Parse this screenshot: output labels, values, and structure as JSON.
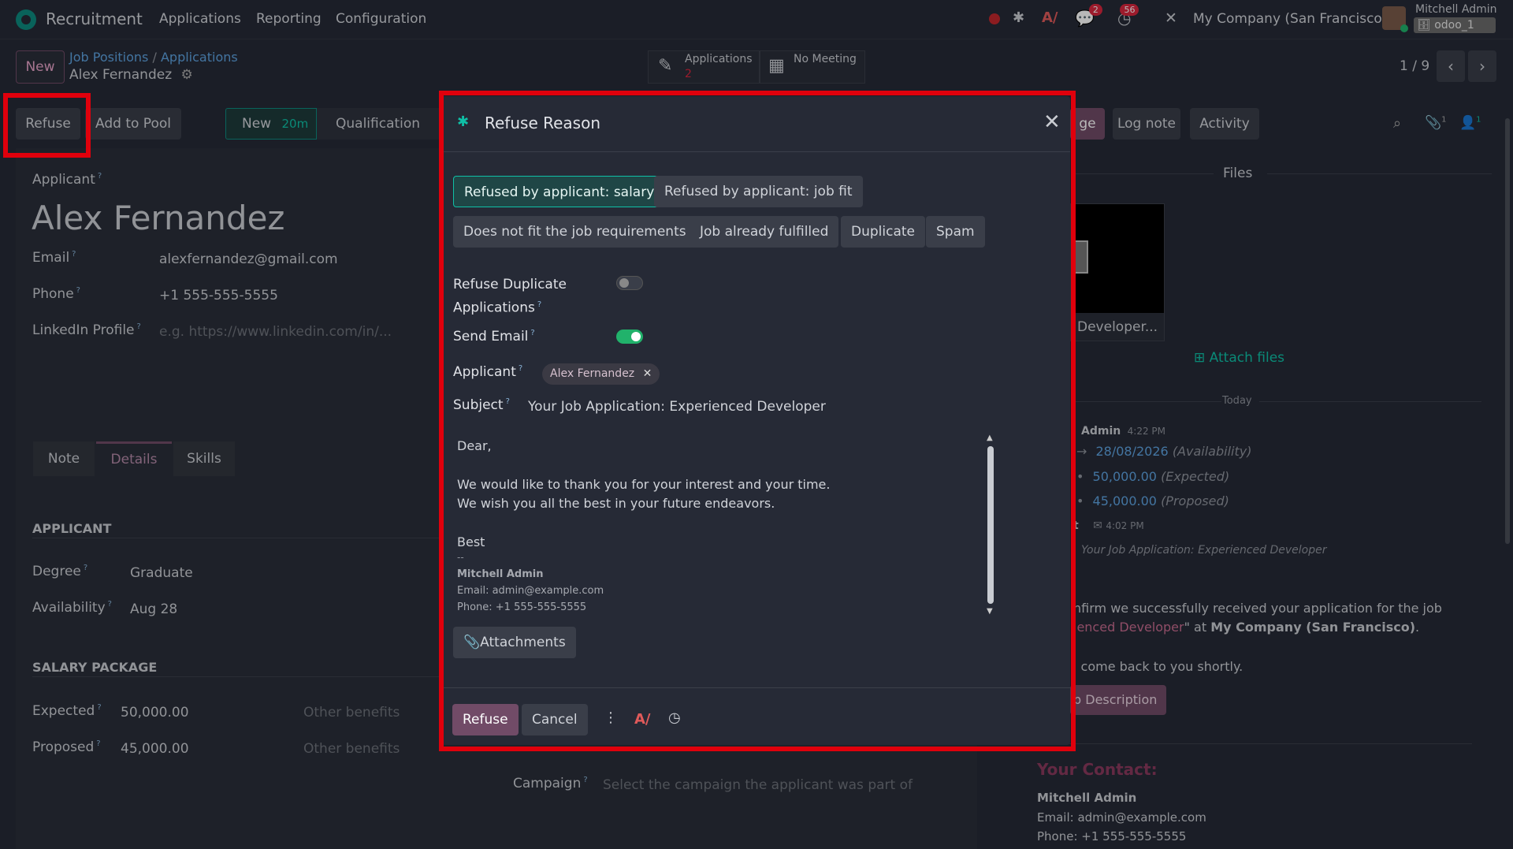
{
  "navbar": {
    "app_name": "Recruitment",
    "menu": [
      "Applications",
      "Reporting",
      "Configuration"
    ],
    "chat_badge": "2",
    "activity_badge": "56",
    "company": "My Company (San Francisco)",
    "user_name": "Mitchell Admin",
    "db_name": "odoo_1"
  },
  "control": {
    "new_button": "New",
    "breadcrumb": [
      "Job Positions",
      "Applications"
    ],
    "record_name": "Alex Fernandez",
    "smart_applications_label": "Applications",
    "smart_applications_count": "2",
    "smart_meeting_label": "No Meeting",
    "pager": "1 / 9"
  },
  "statusbar": {
    "refuse": "Refuse",
    "add_to_pool": "Add to Pool",
    "stage_new": "New",
    "stage_new_time": "20m",
    "stage_qualification": "Qualification"
  },
  "chatter_buttons": {
    "send_message_partial": "ge",
    "log_note": "Log note",
    "activity": "Activity",
    "attach_count": "1",
    "follower_count": "1"
  },
  "form": {
    "applicant_label": "Applicant",
    "applicant_name": "Alex Fernandez",
    "email_label": "Email",
    "email_value": "alexfernandez@gmail.com",
    "phone_label": "Phone",
    "phone_value": "+1 555-555-5555",
    "linkedin_label": "LinkedIn Profile",
    "linkedin_placeholder": "e.g. https://www.linkedin.com/in/...",
    "tabs": [
      "Note",
      "Details",
      "Skills"
    ],
    "section_applicant": "APPLICANT",
    "degree_label": "Degree",
    "degree_value": "Graduate",
    "availability_label": "Availability",
    "availability_value": "Aug 28",
    "section_salary": "SALARY PACKAGE",
    "expected_label": "Expected",
    "expected_value": "50,000.00",
    "proposed_label": "Proposed",
    "proposed_value": "45,000.00",
    "other_benefits": "Other benefits",
    "campaign_label": "Campaign",
    "campaign_placeholder": "Select the campaign the applicant was part of"
  },
  "chatter": {
    "files_title": "Files",
    "file_name": "Developer...",
    "attach_files": "Attach files",
    "today": "Today",
    "msg1_author": "Admin",
    "msg1_time": "4:22 PM",
    "track1_value": "28/08/2026",
    "track1_field": "(Availability)",
    "track2_value": "50,000.00",
    "track2_field": "(Expected)",
    "track3_value": "45,000.00",
    "track3_field": "(Proposed)",
    "msg2_author": "t",
    "msg2_time": "4:02 PM",
    "msg2_subject": "Your Job Application: Experienced Developer",
    "msg2_line1": "nfirm we successfully received your application for the job",
    "msg2_line2_a": "ienced Developer",
    "msg2_line2_b": "\" at ",
    "msg2_line2_c": "My Company (San Francisco)",
    "msg2_line2_d": ".",
    "msg2_line3": "l come back to you shortly.",
    "job_desc_button": "b Description",
    "contact_title": "Your Contact:",
    "contact_name": "Mitchell Admin",
    "contact_email": "Email: admin@example.com",
    "contact_phone": "Phone: +1 555-555-5555"
  },
  "modal": {
    "title": "Refuse Reason",
    "reasons": [
      "Refused by applicant: salary",
      "Refused by applicant: job fit",
      "Does not fit the job requirements",
      "Job already fulfilled",
      "Duplicate",
      "Spam"
    ],
    "dup_label_1": "Refuse Duplicate",
    "dup_label_2": "Applications",
    "send_email_label": "Send Email",
    "applicant_label": "Applicant",
    "applicant_tag": "Alex Fernandez",
    "subject_label": "Subject",
    "subject_value": "Your Job Application: Experienced Developer",
    "body": {
      "greeting": "Dear,",
      "line1": "We would like to thank you for your interest and your time.",
      "line2": "We wish you all the best in your future endeavors.",
      "closing": "Best",
      "sep": "--",
      "sig_name": "Mitchell Admin",
      "sig_email": "Email: admin@example.com",
      "sig_phone": "Phone: +1 555-555-5555"
    },
    "attachments": "Attachments",
    "refuse": "Refuse",
    "cancel": "Cancel"
  },
  "colors": {
    "primary": "#714b67",
    "teal": "#0d8a7f",
    "toggle_on": "#21b26b",
    "highlight": "#e0000c",
    "link": "#5ea2e0"
  }
}
